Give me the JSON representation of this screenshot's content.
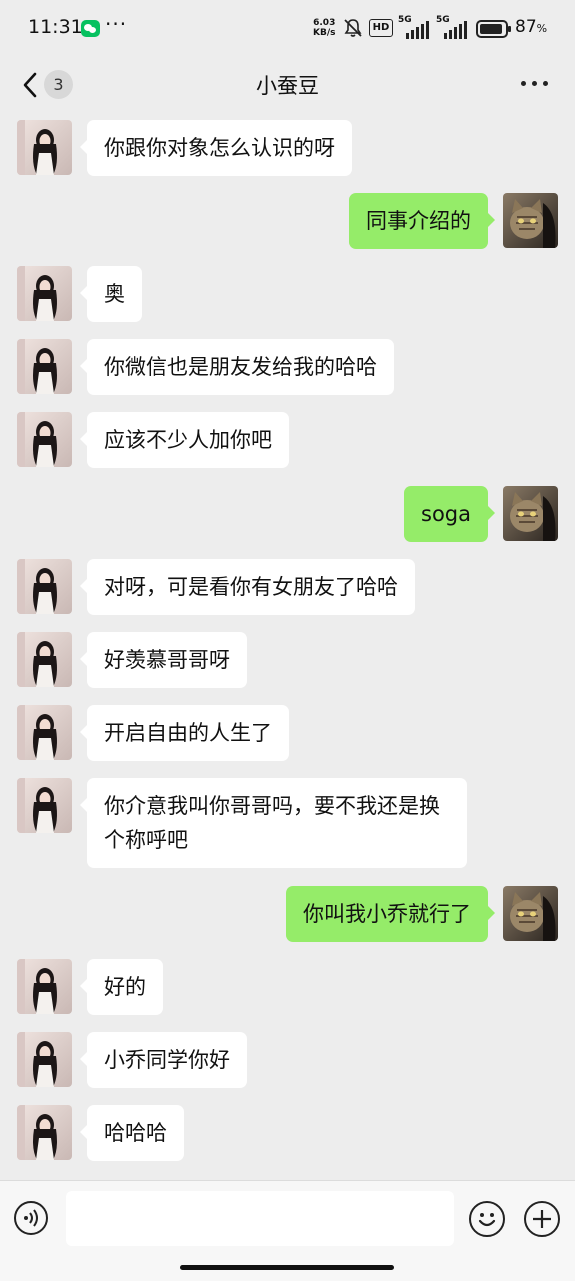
{
  "status_bar": {
    "time": "11:31",
    "more": "···",
    "net_speed_value": "6.03",
    "net_speed_unit": "KB/s",
    "hd_label": "HD",
    "signal1_label": "5G",
    "signal2_label": "5G",
    "battery_percent": "87",
    "battery_unit": "%"
  },
  "header": {
    "unread_count": "3",
    "title": "小蚕豆"
  },
  "messages": [
    {
      "side": "in",
      "text": "你跟你对象怎么认识的呀"
    },
    {
      "side": "out",
      "text": "同事介绍的"
    },
    {
      "side": "in",
      "text": "奥"
    },
    {
      "side": "in",
      "text": "你微信也是朋友发给我的哈哈"
    },
    {
      "side": "in",
      "text": "应该不少人加你吧"
    },
    {
      "side": "out",
      "text": "soga"
    },
    {
      "side": "in",
      "text": "对呀，可是看你有女朋友了哈哈"
    },
    {
      "side": "in",
      "text": "好羡慕哥哥呀"
    },
    {
      "side": "in",
      "text": "开启自由的人生了"
    },
    {
      "side": "in",
      "text": "你介意我叫你哥哥吗，要不我还是换个称呼吧"
    },
    {
      "side": "out",
      "text": "你叫我小乔就行了"
    },
    {
      "side": "in",
      "text": "好的"
    },
    {
      "side": "in",
      "text": "小乔同学你好"
    },
    {
      "side": "in",
      "text": "哈哈哈"
    }
  ],
  "input": {
    "value": "",
    "placeholder": ""
  },
  "icons": {
    "back": "chevron-left-icon",
    "more": "more-horizontal-icon",
    "voice": "voice-icon",
    "emoji": "emoji-icon",
    "plus": "plus-icon",
    "avatar_in": "avatar-girl",
    "avatar_out": "avatar-cat"
  },
  "colors": {
    "background": "#ededed",
    "incoming_bubble": "#ffffff",
    "outgoing_bubble": "#95ec69",
    "wechat_green": "#07c160"
  }
}
